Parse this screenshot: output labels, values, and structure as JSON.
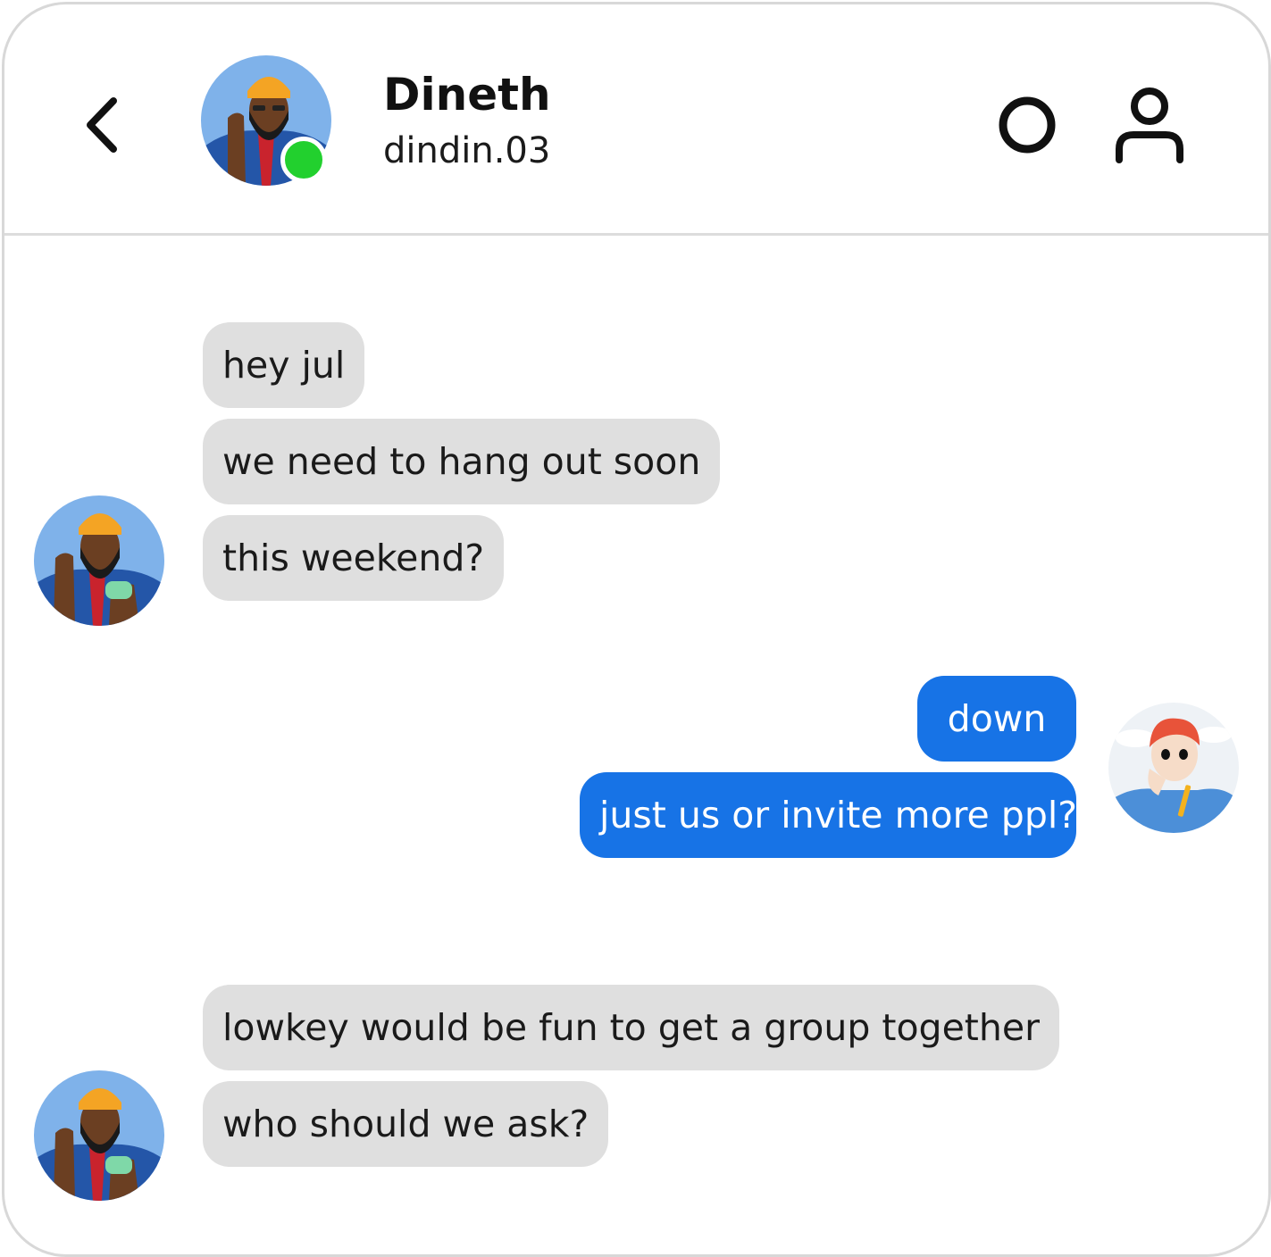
{
  "header": {
    "contact_name": "Dineth",
    "contact_handle": "dindin.03",
    "online_status_color": "#22d02e"
  },
  "icons": {
    "back": "chevron-left-icon",
    "status": "circle-icon",
    "profile": "user-icon"
  },
  "messages": [
    {
      "from": "contact",
      "text": "hey jul"
    },
    {
      "from": "contact",
      "text": "we need to hang out soon"
    },
    {
      "from": "contact",
      "text": "this weekend?"
    },
    {
      "from": "me",
      "text": "down"
    },
    {
      "from": "me",
      "text": "just us or invite more ppl?"
    },
    {
      "from": "contact",
      "text": "lowkey would be fun to get a group together"
    },
    {
      "from": "contact",
      "text": "who should we ask?"
    }
  ],
  "colors": {
    "received_bubble": "#dfdfdf",
    "sent_bubble": "#1773e6",
    "divider": "#dcdcdc"
  }
}
